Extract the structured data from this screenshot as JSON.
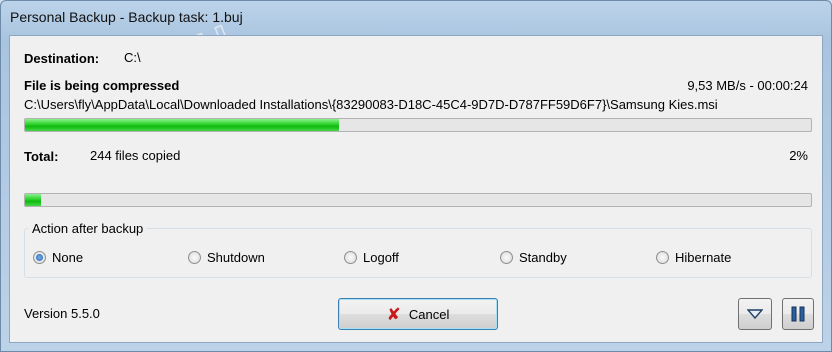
{
  "window": {
    "title": "Personal Backup - Backup task: 1.buj"
  },
  "watermark": {
    "text": "PORTAL"
  },
  "destination": {
    "label": "Destination:",
    "value": "C:\\"
  },
  "current": {
    "status": "File is being compressed",
    "speed_time": "9,53 MB/s - 00:00:24",
    "path": "C:\\Users\\fly\\AppData\\Local\\Downloaded Installations\\{83290083-D18C-45C4-9D7D-D787FF59D6F7}\\Samsung Kies.msi",
    "progress_fraction": 0.4
  },
  "total": {
    "label": "Total:",
    "files_copied": "244 files copied",
    "percent": "2%",
    "progress_fraction": 0.02
  },
  "action_after_backup": {
    "title": "Action after backup",
    "options": [
      {
        "label": "None",
        "selected": true
      },
      {
        "label": "Shutdown",
        "selected": false
      },
      {
        "label": "Logoff",
        "selected": false
      },
      {
        "label": "Standby",
        "selected": false
      },
      {
        "label": "Hibernate",
        "selected": false
      }
    ]
  },
  "footer": {
    "version": "Version 5.5.0",
    "cancel_label": "Cancel",
    "collapse_icon": "triangle-down-icon",
    "pause_icon": "pause-icon"
  },
  "colors": {
    "progress_green": "#1fc41f",
    "cancel_red": "#c8191b"
  }
}
